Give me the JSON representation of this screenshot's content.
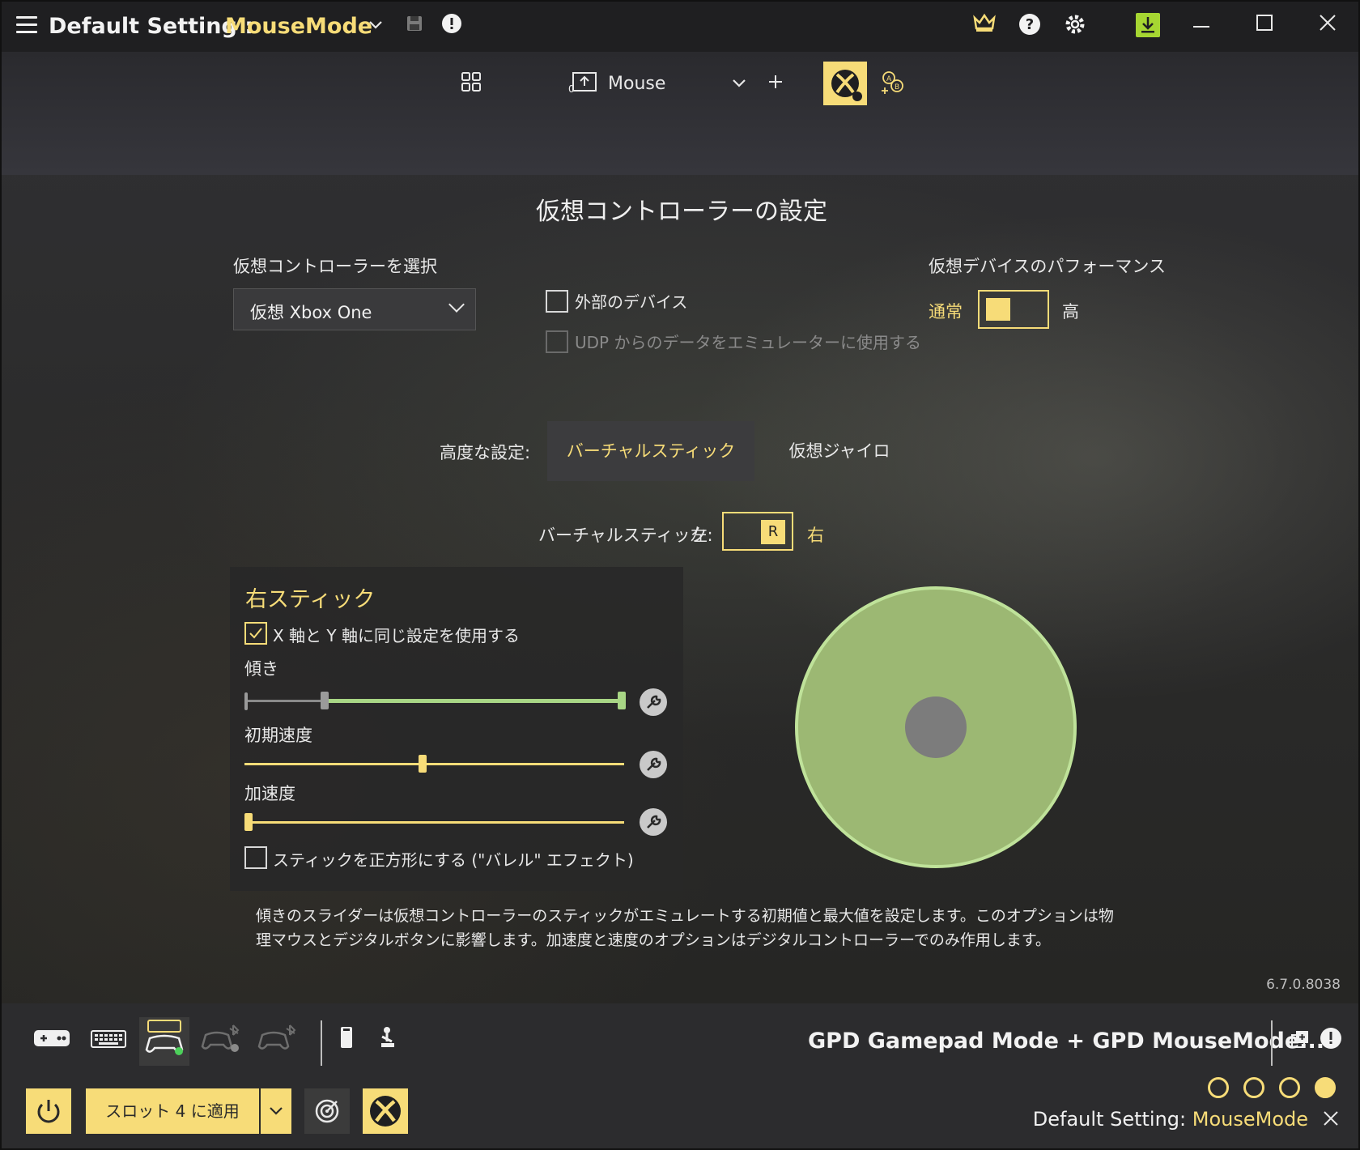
{
  "titlebar": {
    "label": "Default Setting :",
    "mode": "MouseMode"
  },
  "toolbar": {
    "profile_label": "Mouse"
  },
  "page_title": "仮想コントローラーの設定",
  "controller_select": {
    "label": "仮想コントローラーを選択",
    "value": "仮想 Xbox One"
  },
  "external_device": {
    "label": "外部のデバイス",
    "checked": false
  },
  "udp": {
    "label": "UDP からのデータをエミュレーターに使用する",
    "checked": false,
    "enabled": false
  },
  "performance": {
    "label": "仮想デバイスのパフォーマンス",
    "normal": "通常",
    "high": "高"
  },
  "advanced": {
    "label": "高度な設定:",
    "tabs": [
      "バーチャルスティック",
      "仮想ジャイロ"
    ],
    "active_tab": 0
  },
  "virtual_stick": {
    "label": "バーチャルスティック:",
    "left": "左",
    "right": "右",
    "knob": "R"
  },
  "right_stick": {
    "title": "右スティック",
    "same_axis_label": "X 軸と Y 軸に同じ設定を使用する",
    "same_axis_checked": true,
    "tilt_label": "傾き",
    "tilt_min": 0.21,
    "tilt_max": 1.0,
    "initial_speed_label": "初期速度",
    "initial_speed": 0.47,
    "accel_label": "加速度",
    "accel": 0.0,
    "square_label": "スティックを正方形にする (\"バレル\" エフェクト)",
    "square_checked": false
  },
  "description": "傾きのスライダーは仮想コントローラーのスティックがエミュレートする初期値と最大値を設定します。このオプションは物理マウスとデジタルボタンに影響します。加速度と速度のオプションはデジタルコントローラーでのみ作用します。",
  "version": "6.7.0.8038",
  "bottom": {
    "status": "GPD Gamepad Mode + GPD MouseMode...",
    "apply_label": "スロット 4 に適用",
    "footer_label": "Default Setting: ",
    "footer_mode": "MouseMode"
  },
  "colors": {
    "accent": "#f7dc78",
    "stick": "#9cb873",
    "slider_green": "#a8d685"
  }
}
